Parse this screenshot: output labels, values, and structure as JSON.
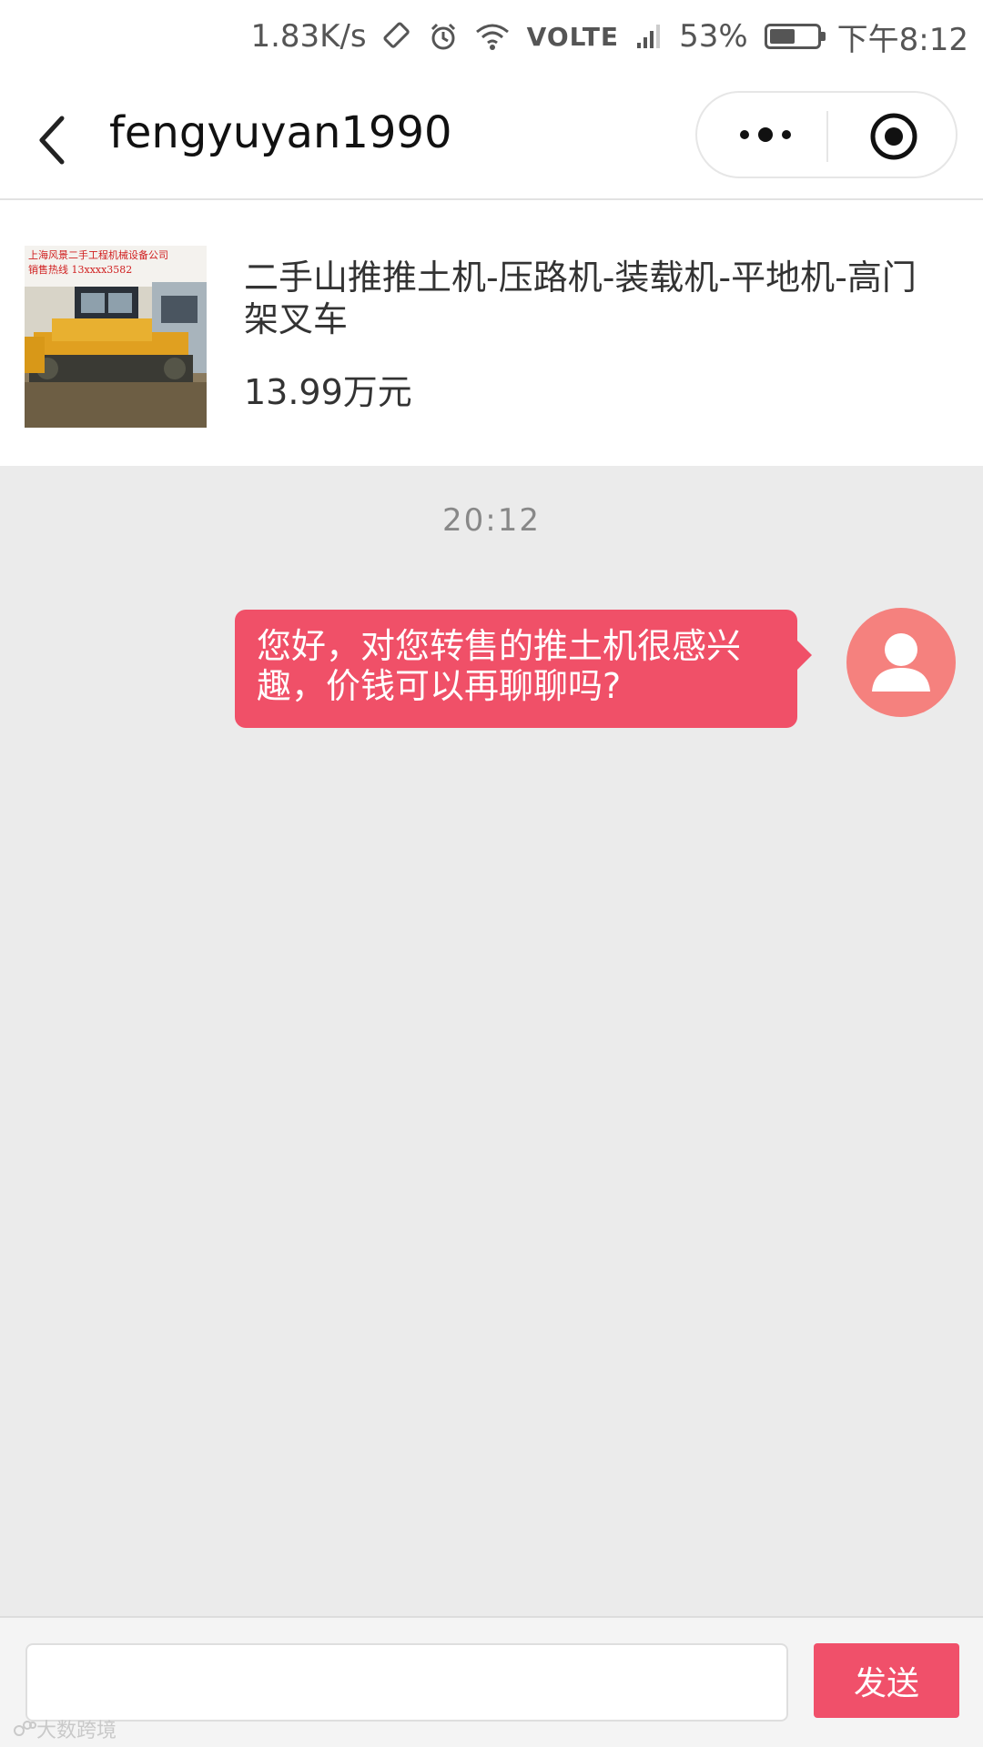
{
  "status_bar": {
    "speed": "1.83K/s",
    "network": "VOLTE",
    "battery": "53%",
    "battery_level": 0.53,
    "time": "下午8:12"
  },
  "header": {
    "title": "fengyuyan1990"
  },
  "product": {
    "title": "二手山推推土机-压路机-装载机-平地机-高门架叉车",
    "price": "13.99万元",
    "thumb_text_1": "上海风景二手工程机械设备公司",
    "thumb_text_2": "销售热线 13xxxx3582"
  },
  "chat": {
    "timestamp": "20:12",
    "messages": [
      {
        "text": "您好，对您转售的推土机很感兴趣，价钱可以再聊聊吗?",
        "from": "me"
      }
    ]
  },
  "composer": {
    "placeholder": "",
    "send_label": "发送"
  },
  "watermark": "大数跨境",
  "colors": {
    "accent": "#f05068",
    "avatar": "#f5817e",
    "background": "#ebebeb"
  }
}
